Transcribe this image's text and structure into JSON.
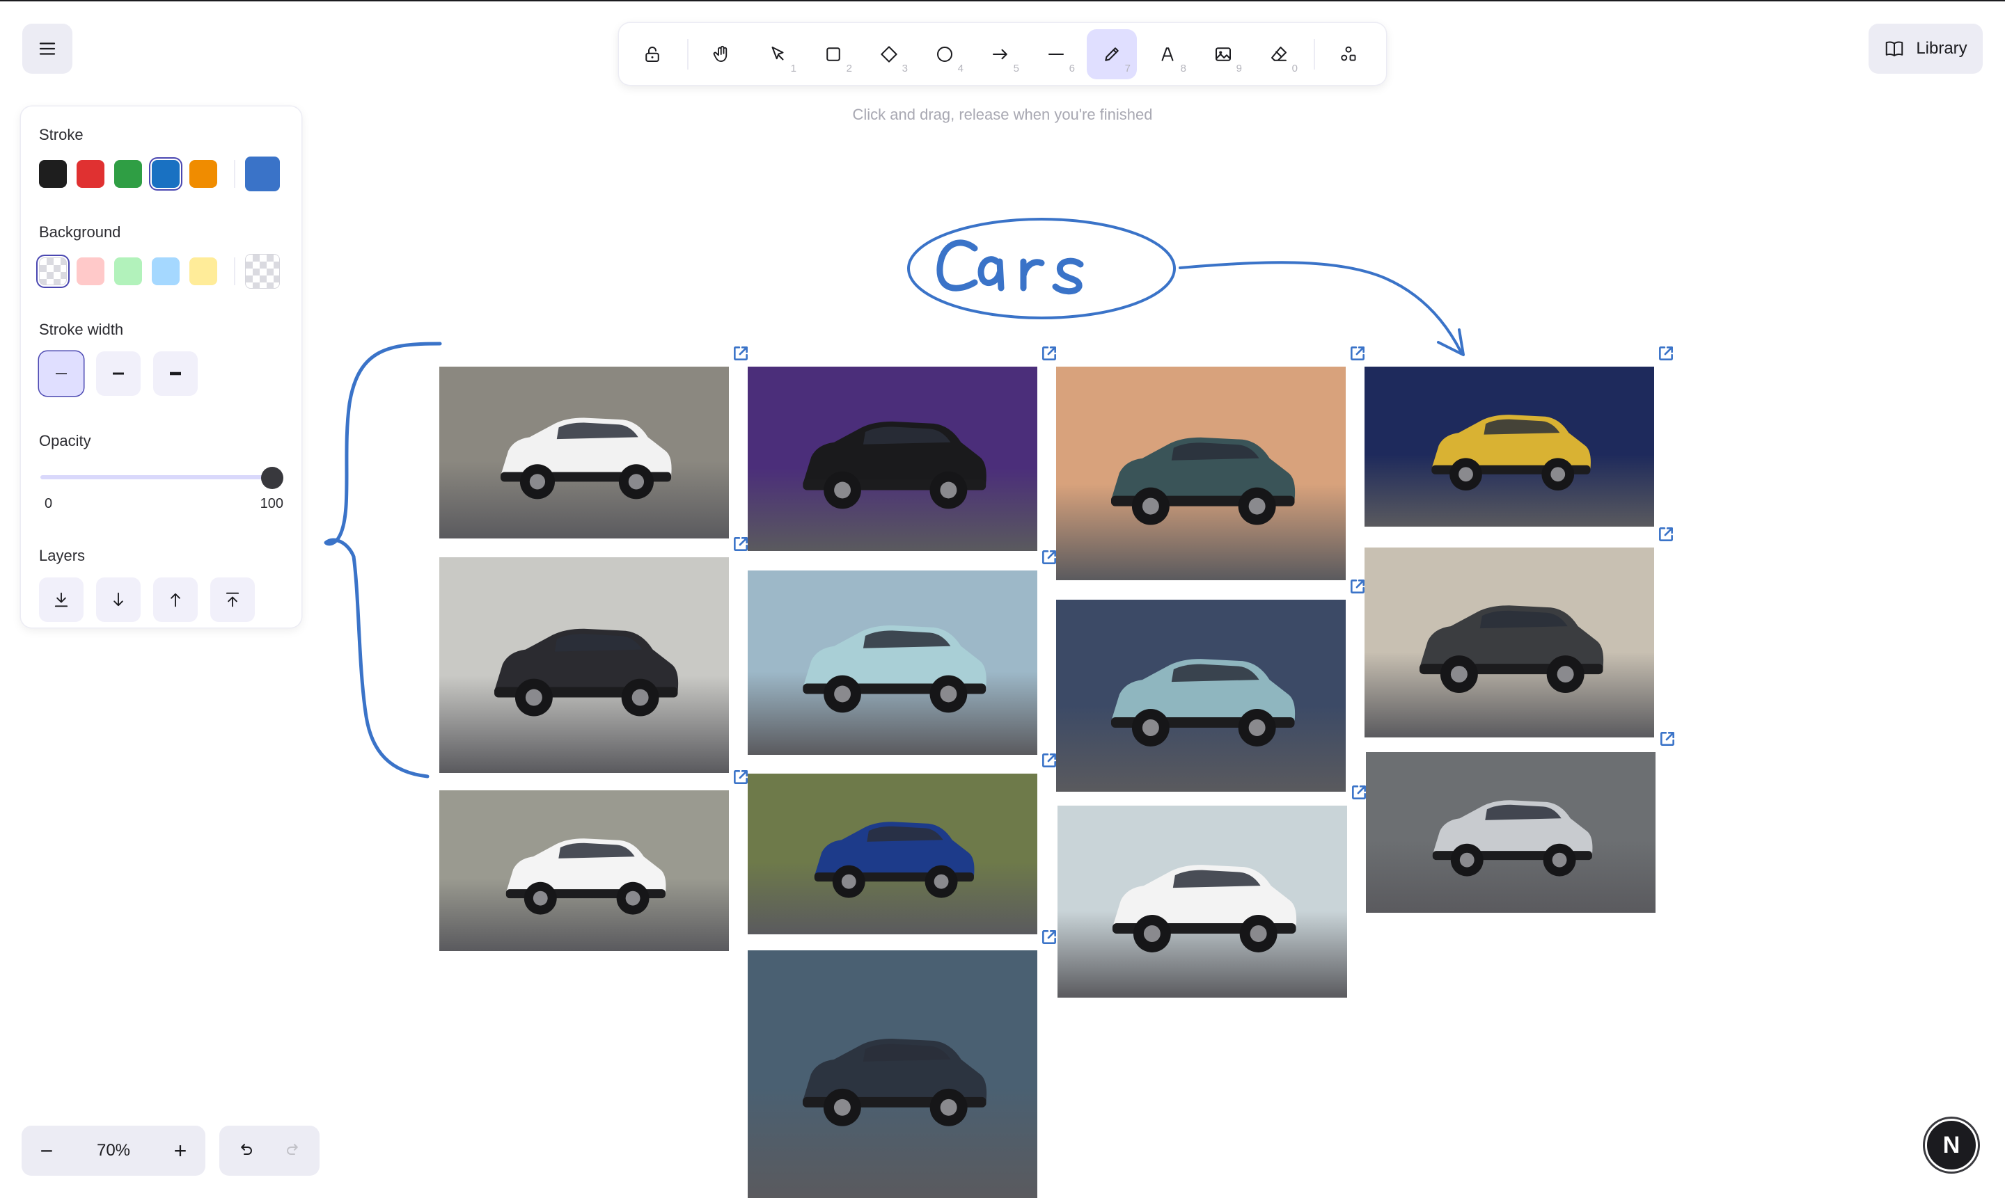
{
  "toolbar": {
    "hint": "Click and drag, release when you're finished",
    "tools": [
      {
        "name": "lock-tool",
        "icon": "lock-icon",
        "key": ""
      },
      {
        "name": "hand-tool",
        "icon": "hand-icon",
        "key": ""
      },
      {
        "name": "selection-tool",
        "icon": "pointer-icon",
        "key": "1"
      },
      {
        "name": "rectangle-tool",
        "icon": "square-icon",
        "key": "2"
      },
      {
        "name": "diamond-tool",
        "icon": "diamond-icon",
        "key": "3"
      },
      {
        "name": "ellipse-tool",
        "icon": "circle-icon",
        "key": "4"
      },
      {
        "name": "arrow-tool",
        "icon": "arrow-icon",
        "key": "5"
      },
      {
        "name": "line-tool",
        "icon": "line-icon",
        "key": "6"
      },
      {
        "name": "draw-tool",
        "icon": "pencil-icon",
        "key": "7",
        "active": true
      },
      {
        "name": "text-tool",
        "icon": "text-icon",
        "key": "8"
      },
      {
        "name": "image-tool",
        "icon": "image-icon",
        "key": "9"
      },
      {
        "name": "eraser-tool",
        "icon": "eraser-icon",
        "key": "0"
      },
      {
        "name": "more-tools",
        "icon": "shapes-icon",
        "key": ""
      }
    ]
  },
  "library": {
    "label": "Library"
  },
  "properties": {
    "stroke_label": "Stroke",
    "stroke_colors": [
      "#1e1e1e",
      "#e03131",
      "#2f9e44",
      "#1971c2",
      "#f08c00"
    ],
    "stroke_selected_index": 3,
    "stroke_current": "#3a73c8",
    "background_label": "Background",
    "background_colors": [
      "transparent",
      "#ffc9c9",
      "#b2f2bb",
      "#a5d8ff",
      "#ffec99"
    ],
    "background_selected_index": 0,
    "stroke_width_label": "Stroke width",
    "opacity_label": "Opacity",
    "opacity_min": "0",
    "opacity_max": "100",
    "opacity_value": 100,
    "layers_label": "Layers"
  },
  "zoom": {
    "value": "70%",
    "minus": "−",
    "plus": "+"
  },
  "canvas": {
    "title": "Cars",
    "accent": "#3a73c8",
    "photos": [
      {
        "name": "photo-white-suv",
        "bg": "#8b8880",
        "body": "#f2f2f2"
      },
      {
        "name": "photo-black-suv-purple",
        "bg": "#4b2e7a",
        "body": "#1a1a1c"
      },
      {
        "name": "photo-dusty-suv",
        "bg": "#d8a27c",
        "body": "#3a5458"
      },
      {
        "name": "photo-yellow-suv",
        "bg": "#1e2a5c",
        "body": "#d9b233"
      },
      {
        "name": "photo-dark-suv",
        "bg": "#c9c9c5",
        "body": "#2b2b30"
      },
      {
        "name": "photo-mint-suv",
        "bg": "#9db8c8",
        "body": "#a9cfd6"
      },
      {
        "name": "photo-sunset-suv",
        "bg": "#3c4a66",
        "body": "#8fb6bf"
      },
      {
        "name": "photo-motion-suv",
        "bg": "#c8c0b2",
        "body": "#3b3d40"
      },
      {
        "name": "photo-white-hatch-city",
        "bg": "#9a9a90",
        "body": "#f4f4f4"
      },
      {
        "name": "photo-blue-hatch",
        "bg": "#6e7a4a",
        "body": "#1d3b8a"
      },
      {
        "name": "photo-white-compact-suv",
        "bg": "#c9d4d8",
        "body": "#f3f3f3"
      },
      {
        "name": "photo-silver-hatch",
        "bg": "#6c6f72",
        "body": "#c8cbcf"
      },
      {
        "name": "photo-building-hatch",
        "bg": "#4a6072",
        "body": "#2c3440"
      }
    ]
  }
}
